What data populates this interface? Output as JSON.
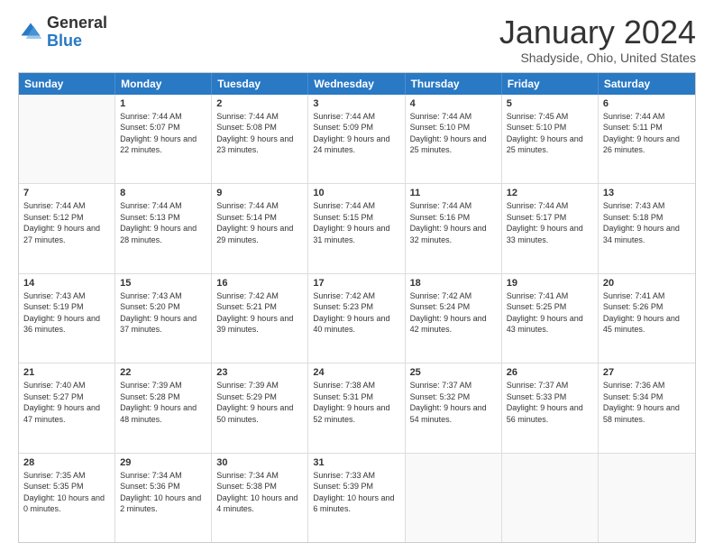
{
  "logo": {
    "general": "General",
    "blue": "Blue"
  },
  "title": "January 2024",
  "location": "Shadyside, Ohio, United States",
  "header_days": [
    "Sunday",
    "Monday",
    "Tuesday",
    "Wednesday",
    "Thursday",
    "Friday",
    "Saturday"
  ],
  "weeks": [
    [
      {
        "day": "",
        "sunrise": "",
        "sunset": "",
        "daylight": ""
      },
      {
        "day": "1",
        "sunrise": "Sunrise: 7:44 AM",
        "sunset": "Sunset: 5:07 PM",
        "daylight": "Daylight: 9 hours and 22 minutes."
      },
      {
        "day": "2",
        "sunrise": "Sunrise: 7:44 AM",
        "sunset": "Sunset: 5:08 PM",
        "daylight": "Daylight: 9 hours and 23 minutes."
      },
      {
        "day": "3",
        "sunrise": "Sunrise: 7:44 AM",
        "sunset": "Sunset: 5:09 PM",
        "daylight": "Daylight: 9 hours and 24 minutes."
      },
      {
        "day": "4",
        "sunrise": "Sunrise: 7:44 AM",
        "sunset": "Sunset: 5:10 PM",
        "daylight": "Daylight: 9 hours and 25 minutes."
      },
      {
        "day": "5",
        "sunrise": "Sunrise: 7:45 AM",
        "sunset": "Sunset: 5:10 PM",
        "daylight": "Daylight: 9 hours and 25 minutes."
      },
      {
        "day": "6",
        "sunrise": "Sunrise: 7:44 AM",
        "sunset": "Sunset: 5:11 PM",
        "daylight": "Daylight: 9 hours and 26 minutes."
      }
    ],
    [
      {
        "day": "7",
        "sunrise": "Sunrise: 7:44 AM",
        "sunset": "Sunset: 5:12 PM",
        "daylight": "Daylight: 9 hours and 27 minutes."
      },
      {
        "day": "8",
        "sunrise": "Sunrise: 7:44 AM",
        "sunset": "Sunset: 5:13 PM",
        "daylight": "Daylight: 9 hours and 28 minutes."
      },
      {
        "day": "9",
        "sunrise": "Sunrise: 7:44 AM",
        "sunset": "Sunset: 5:14 PM",
        "daylight": "Daylight: 9 hours and 29 minutes."
      },
      {
        "day": "10",
        "sunrise": "Sunrise: 7:44 AM",
        "sunset": "Sunset: 5:15 PM",
        "daylight": "Daylight: 9 hours and 31 minutes."
      },
      {
        "day": "11",
        "sunrise": "Sunrise: 7:44 AM",
        "sunset": "Sunset: 5:16 PM",
        "daylight": "Daylight: 9 hours and 32 minutes."
      },
      {
        "day": "12",
        "sunrise": "Sunrise: 7:44 AM",
        "sunset": "Sunset: 5:17 PM",
        "daylight": "Daylight: 9 hours and 33 minutes."
      },
      {
        "day": "13",
        "sunrise": "Sunrise: 7:43 AM",
        "sunset": "Sunset: 5:18 PM",
        "daylight": "Daylight: 9 hours and 34 minutes."
      }
    ],
    [
      {
        "day": "14",
        "sunrise": "Sunrise: 7:43 AM",
        "sunset": "Sunset: 5:19 PM",
        "daylight": "Daylight: 9 hours and 36 minutes."
      },
      {
        "day": "15",
        "sunrise": "Sunrise: 7:43 AM",
        "sunset": "Sunset: 5:20 PM",
        "daylight": "Daylight: 9 hours and 37 minutes."
      },
      {
        "day": "16",
        "sunrise": "Sunrise: 7:42 AM",
        "sunset": "Sunset: 5:21 PM",
        "daylight": "Daylight: 9 hours and 39 minutes."
      },
      {
        "day": "17",
        "sunrise": "Sunrise: 7:42 AM",
        "sunset": "Sunset: 5:23 PM",
        "daylight": "Daylight: 9 hours and 40 minutes."
      },
      {
        "day": "18",
        "sunrise": "Sunrise: 7:42 AM",
        "sunset": "Sunset: 5:24 PM",
        "daylight": "Daylight: 9 hours and 42 minutes."
      },
      {
        "day": "19",
        "sunrise": "Sunrise: 7:41 AM",
        "sunset": "Sunset: 5:25 PM",
        "daylight": "Daylight: 9 hours and 43 minutes."
      },
      {
        "day": "20",
        "sunrise": "Sunrise: 7:41 AM",
        "sunset": "Sunset: 5:26 PM",
        "daylight": "Daylight: 9 hours and 45 minutes."
      }
    ],
    [
      {
        "day": "21",
        "sunrise": "Sunrise: 7:40 AM",
        "sunset": "Sunset: 5:27 PM",
        "daylight": "Daylight: 9 hours and 47 minutes."
      },
      {
        "day": "22",
        "sunrise": "Sunrise: 7:39 AM",
        "sunset": "Sunset: 5:28 PM",
        "daylight": "Daylight: 9 hours and 48 minutes."
      },
      {
        "day": "23",
        "sunrise": "Sunrise: 7:39 AM",
        "sunset": "Sunset: 5:29 PM",
        "daylight": "Daylight: 9 hours and 50 minutes."
      },
      {
        "day": "24",
        "sunrise": "Sunrise: 7:38 AM",
        "sunset": "Sunset: 5:31 PM",
        "daylight": "Daylight: 9 hours and 52 minutes."
      },
      {
        "day": "25",
        "sunrise": "Sunrise: 7:37 AM",
        "sunset": "Sunset: 5:32 PM",
        "daylight": "Daylight: 9 hours and 54 minutes."
      },
      {
        "day": "26",
        "sunrise": "Sunrise: 7:37 AM",
        "sunset": "Sunset: 5:33 PM",
        "daylight": "Daylight: 9 hours and 56 minutes."
      },
      {
        "day": "27",
        "sunrise": "Sunrise: 7:36 AM",
        "sunset": "Sunset: 5:34 PM",
        "daylight": "Daylight: 9 hours and 58 minutes."
      }
    ],
    [
      {
        "day": "28",
        "sunrise": "Sunrise: 7:35 AM",
        "sunset": "Sunset: 5:35 PM",
        "daylight": "Daylight: 10 hours and 0 minutes."
      },
      {
        "day": "29",
        "sunrise": "Sunrise: 7:34 AM",
        "sunset": "Sunset: 5:36 PM",
        "daylight": "Daylight: 10 hours and 2 minutes."
      },
      {
        "day": "30",
        "sunrise": "Sunrise: 7:34 AM",
        "sunset": "Sunset: 5:38 PM",
        "daylight": "Daylight: 10 hours and 4 minutes."
      },
      {
        "day": "31",
        "sunrise": "Sunrise: 7:33 AM",
        "sunset": "Sunset: 5:39 PM",
        "daylight": "Daylight: 10 hours and 6 minutes."
      },
      {
        "day": "",
        "sunrise": "",
        "sunset": "",
        "daylight": ""
      },
      {
        "day": "",
        "sunrise": "",
        "sunset": "",
        "daylight": ""
      },
      {
        "day": "",
        "sunrise": "",
        "sunset": "",
        "daylight": ""
      }
    ]
  ]
}
